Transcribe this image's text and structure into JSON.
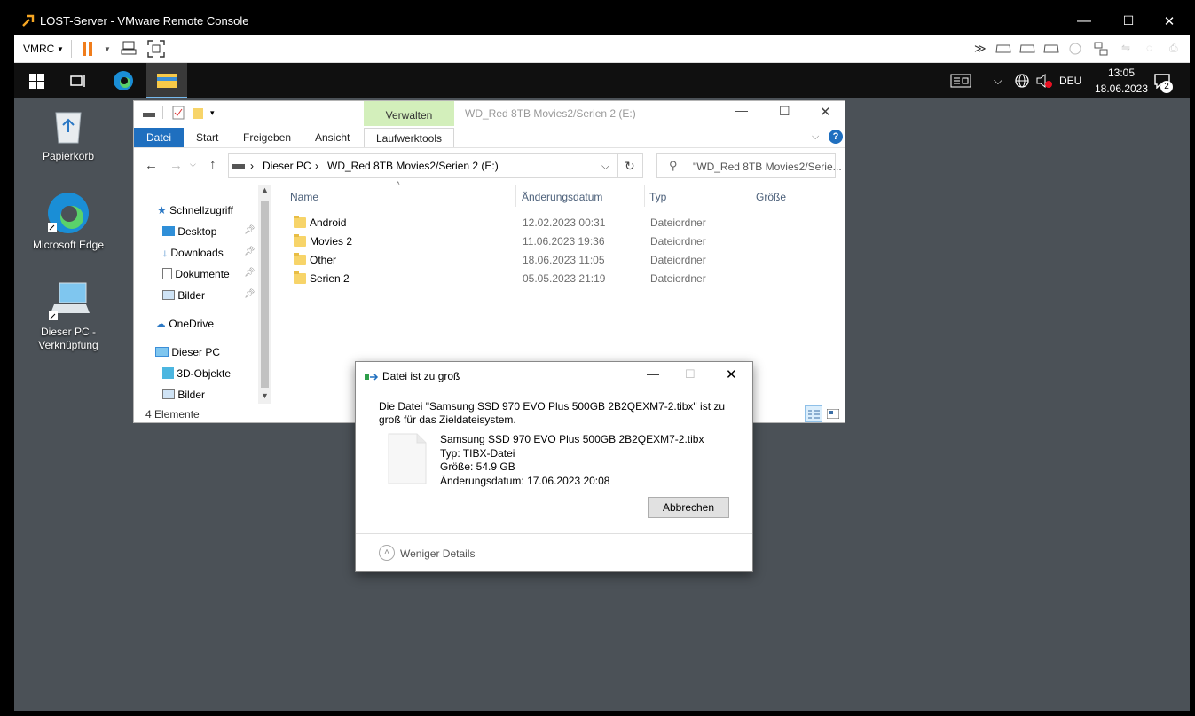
{
  "vmrc": {
    "title": "LOST-Server - VMware Remote Console",
    "menu_label": "VMRC",
    "window_buttons": {
      "min": "—",
      "max": "☐",
      "close": "✕"
    }
  },
  "taskbar": {
    "lang": "DEU",
    "time": "13:05",
    "date": "18.06.2023",
    "notif_count": "2"
  },
  "desktop": {
    "icons": [
      {
        "label": "Papierkorb"
      },
      {
        "label": "Microsoft Edge"
      },
      {
        "label": "Dieser PC - Verknüpfung"
      }
    ]
  },
  "explorer": {
    "title": "WD_Red 8TB Movies2/Serien 2 (E:)",
    "manage_tab": "Verwalten",
    "tabs": [
      "Datei",
      "Start",
      "Freigeben",
      "Ansicht",
      "Laufwerktools"
    ],
    "breadcrumb": [
      "Dieser PC",
      "WD_Red 8TB Movies2/Serien 2 (E:)"
    ],
    "search_placeholder": "\"WD_Red 8TB Movies2/Serie...",
    "columns": [
      "Name",
      "Änderungsdatum",
      "Typ",
      "Größe"
    ],
    "nav": [
      "Schnellzugriff",
      "Desktop",
      "Downloads",
      "Dokumente",
      "Bilder",
      "OneDrive",
      "Dieser PC",
      "3D-Objekte",
      "Bilder"
    ],
    "rows": [
      {
        "name": "Android",
        "date": "12.02.2023 00:31",
        "type": "Dateiordner"
      },
      {
        "name": "Movies 2",
        "date": "11.06.2023 19:36",
        "type": "Dateiordner"
      },
      {
        "name": "Other",
        "date": "18.06.2023 11:05",
        "type": "Dateiordner"
      },
      {
        "name": "Serien 2",
        "date": "05.05.2023 21:19",
        "type": "Dateiordner"
      }
    ],
    "status": "4 Elemente"
  },
  "dialog": {
    "title": "Datei ist zu groß",
    "message": "Die Datei \"Samsung SSD 970 EVO Plus 500GB 2B2QEXM7-2.tibx\" ist zu groß für das Zieldateisystem.",
    "file_name": "Samsung SSD 970 EVO Plus 500GB 2B2QEXM7-2.tibx",
    "file_type": "Typ: TIBX-Datei",
    "file_size": "Größe: 54.9 GB",
    "file_date": "Änderungsdatum: 17.06.2023 20:08",
    "cancel": "Abbrechen",
    "less_details": "Weniger Details"
  }
}
